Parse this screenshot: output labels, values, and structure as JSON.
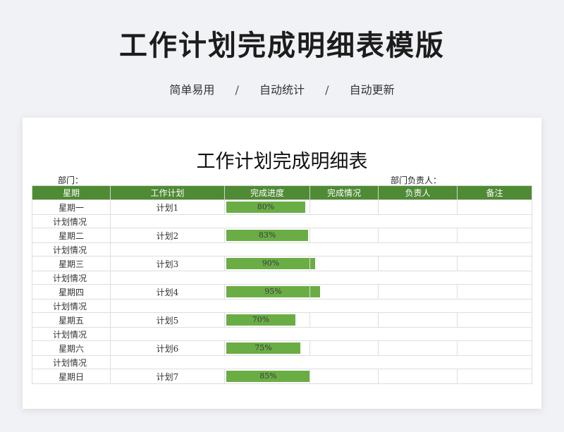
{
  "header": {
    "title": "工作计划完成明细表模版",
    "features": [
      "简单易用",
      "自动统计",
      "自动更新"
    ],
    "separator": "/"
  },
  "sheet": {
    "title": "工作计划完成明细表",
    "department_label": "部门：",
    "owner_label": "部门负责人：",
    "columns": [
      "星期",
      "工作计划",
      "完成进度",
      "完成情况",
      "负责人",
      "备注"
    ],
    "note_label": "计划情况",
    "rows": [
      {
        "day": "星期一",
        "plan": "计划1",
        "progress": 0.8,
        "progress_label": "80%"
      },
      {
        "day": "星期二",
        "plan": "计划2",
        "progress": 0.83,
        "progress_label": "83%"
      },
      {
        "day": "星期三",
        "plan": "计划3",
        "progress": 0.9,
        "progress_label": "90%"
      },
      {
        "day": "星期四",
        "plan": "计划4",
        "progress": 0.95,
        "progress_label": "95%"
      },
      {
        "day": "星期五",
        "plan": "计划5",
        "progress": 0.7,
        "progress_label": "70%"
      },
      {
        "day": "星期六",
        "plan": "计划6",
        "progress": 0.75,
        "progress_label": "75%"
      },
      {
        "day": "星期日",
        "plan": "计划7",
        "progress": 0.85,
        "progress_label": "85%"
      }
    ]
  },
  "colors": {
    "header_green": "#4f8a35",
    "bar_green": "#6aad45"
  }
}
